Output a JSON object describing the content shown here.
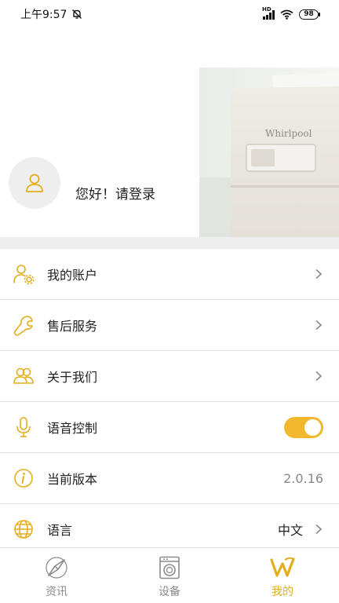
{
  "status_bar": {
    "time": "上午9:57",
    "battery": "98",
    "network": "HD"
  },
  "header": {
    "greeting": "您好！请登录",
    "brand": "Whirlpool"
  },
  "menu": {
    "items": [
      {
        "label": "我的账户",
        "icon": "account-settings-icon"
      },
      {
        "label": "售后服务",
        "icon": "wrench-icon"
      },
      {
        "label": "关于我们",
        "icon": "people-icon"
      },
      {
        "label": "语音控制",
        "icon": "microphone-icon",
        "toggle": true
      },
      {
        "label": "当前版本",
        "icon": "info-icon",
        "value": "2.0.16"
      },
      {
        "label": "语言",
        "icon": "globe-icon",
        "value": "中文"
      }
    ]
  },
  "tabbar": {
    "tabs": [
      {
        "label": "资讯",
        "icon": "compass-icon",
        "active": false
      },
      {
        "label": "设备",
        "icon": "washer-icon",
        "active": false
      },
      {
        "label": "我的",
        "icon": "whirlpool-w-icon",
        "active": true
      }
    ]
  },
  "colors": {
    "accent": "#e4ad1c",
    "toggle_on": "#f1b82d",
    "divider": "#eeeeee"
  }
}
